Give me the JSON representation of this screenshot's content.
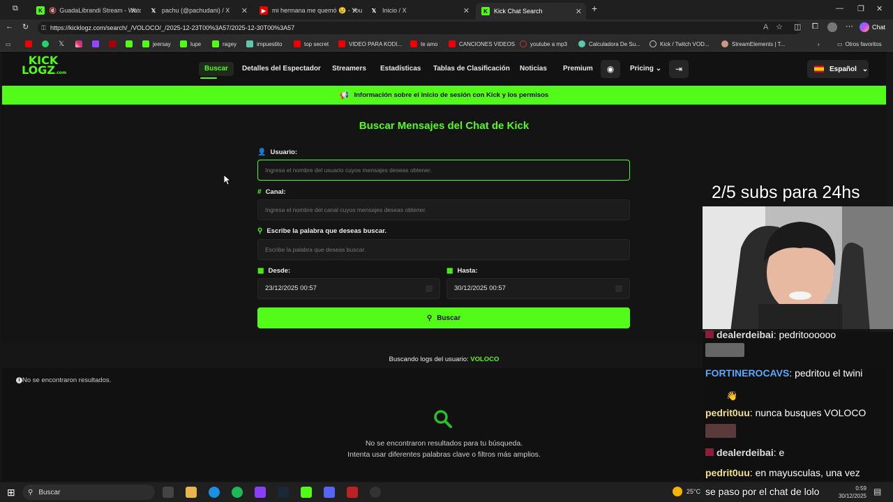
{
  "browser": {
    "tabs": [
      {
        "title": "GuadaLibrandi Stream - Watc",
        "icon": "kick-icon"
      },
      {
        "title": "pachu (@pachudani) / X",
        "icon": "x-icon"
      },
      {
        "title": "mi hermana me quemó 😢 - You",
        "icon": "youtube-icon"
      },
      {
        "title": "Inicio / X",
        "icon": "x-icon"
      },
      {
        "title": "Kick Chat Search",
        "icon": "kick-icon"
      }
    ],
    "url": "https://kicklogz.com/search/_/VOLOCO/_/2025-12-23T00%3A57/2025-12-30T00%3A57",
    "copilot_label": "Chat",
    "bookmarks": [
      "jeersay",
      "lupe",
      "ragey",
      "impuestito",
      "top secret",
      "VIDEO PARA KODI...",
      "te amo",
      "CANCIONES VIDEOS",
      "youtube a mp3",
      "Calculadora De Su...",
      "Kick / Twitch VOD...",
      "StreamElements | T..."
    ],
    "other_favorites": "Otros favoritos"
  },
  "site": {
    "logo_line1": "KICK",
    "logo_line2": "LOGZ",
    "logo_suffix": ".com",
    "nav": {
      "buscar": "Buscar",
      "detalles": "Detalles del Espectador",
      "streamers": "Streamers",
      "estadisticas": "Estadísticas",
      "tablas": "Tablas de Clasificación",
      "noticias": "Noticias",
      "premium": "Premium",
      "pricing": "Pricing",
      "language": "Español"
    },
    "banner": "Información sobre el inicio de sesión con Kick y los permisos",
    "title": "Buscar Mensajes del Chat de Kick",
    "form": {
      "usuario_label": "Usuario:",
      "usuario_placeholder": "Ingresa el nombre del usuario cuyos mensajes deseas obtener.",
      "canal_label": "Canal:",
      "canal_placeholder": "Ingresa el nombre del canal cuyos mensajes deseas obtener.",
      "palabra_label": "Escribe la palabra que deseas buscar.",
      "palabra_placeholder": "Escribe la palabra que deseas buscar.",
      "desde_label": "Desde:",
      "desde_value": "23/12/2025 00:57",
      "hasta_label": "Hasta:",
      "hasta_value": "30/12/2025 00:57",
      "buscar_button": "Buscar"
    },
    "results": {
      "searching_prefix": "Buscando logs del usuario:",
      "searching_user": "VOLOCO",
      "none_found_info": "No se encontraron resultados.",
      "empty_line1": "No se encontraron resultados para tu búsqueda.",
      "empty_line2": "Intenta usar diferentes palabras clave o filtros más amplios."
    }
  },
  "overlay": {
    "subs_text": "2/5 subs para 24hs",
    "chat": [
      {
        "user": "dealerdeibai",
        "msg": "pedritoooooo"
      },
      {
        "user": "FORTINEROCAVS",
        "msg": "pedritou el twini"
      },
      {
        "user": "pedrit0uu",
        "msg": "nunca busques VOLOCO"
      },
      {
        "user": "dealerdeibai",
        "msg": "e"
      },
      {
        "user": "pedrit0uu",
        "msg": "en mayusculas, una vez"
      },
      {
        "user": "",
        "msg": "se paso por el chat de lolo"
      }
    ]
  },
  "taskbar": {
    "search": "Buscar",
    "temp": "25°C",
    "time": "0:59",
    "date": "30/12/2025"
  },
  "colors": {
    "accent": "#53fc18",
    "bg": "#141414"
  }
}
